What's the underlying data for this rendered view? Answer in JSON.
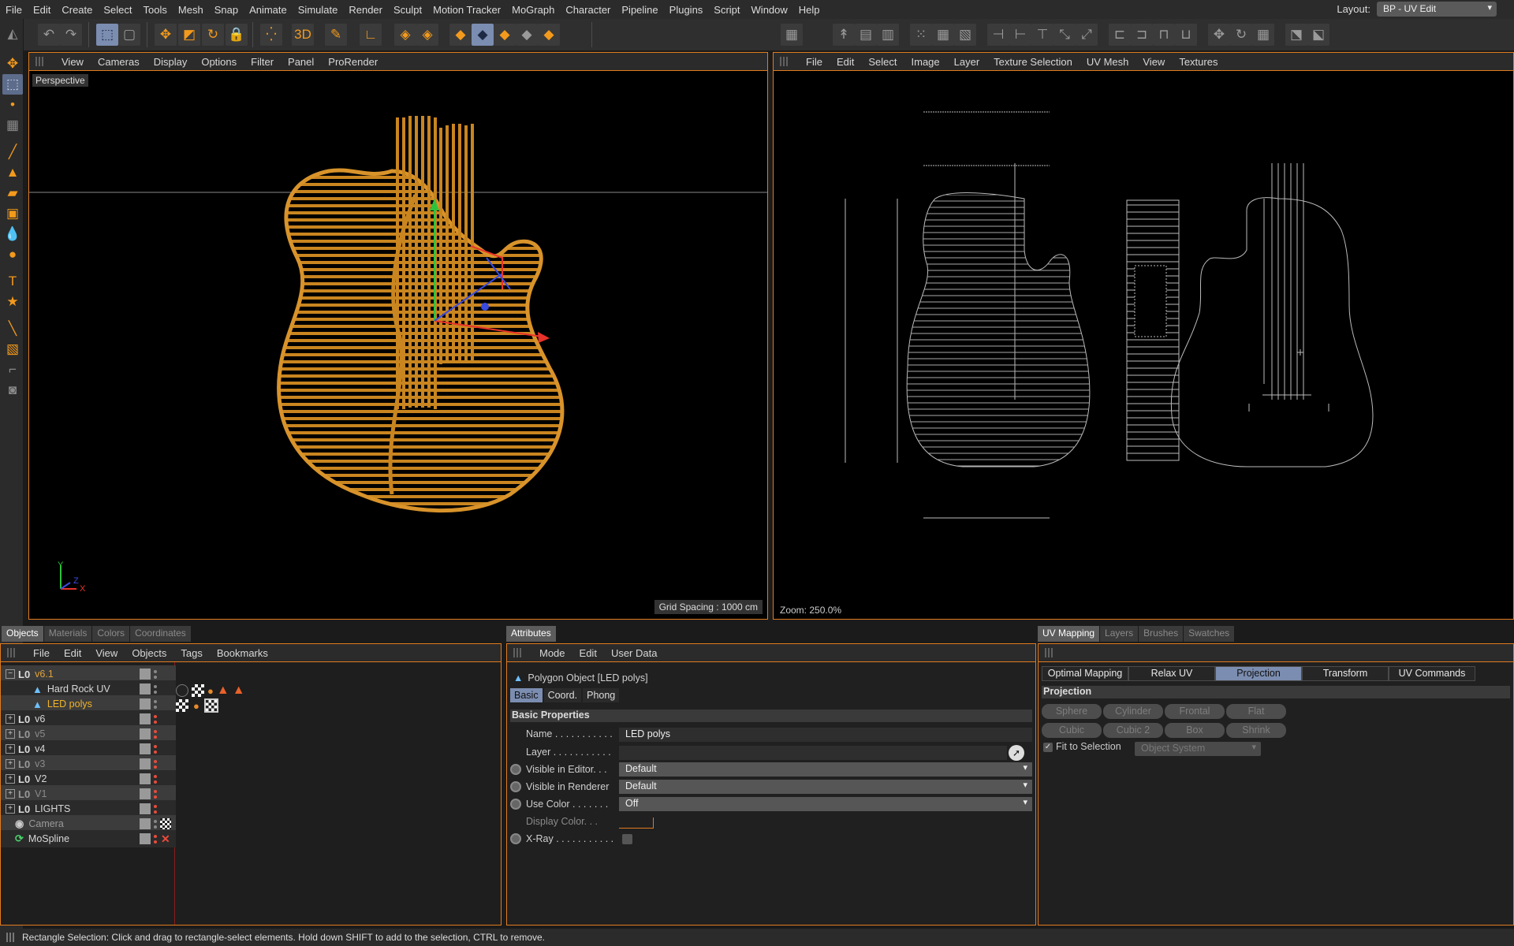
{
  "menubar": {
    "items": [
      "File",
      "Edit",
      "Create",
      "Select",
      "Tools",
      "Mesh",
      "Snap",
      "Animate",
      "Simulate",
      "Render",
      "Sculpt",
      "Motion Tracker",
      "MoGraph",
      "Character",
      "Pipeline",
      "Plugins",
      "Script",
      "Window",
      "Help"
    ],
    "layout_label": "Layout:",
    "layout_value": "BP - UV Edit"
  },
  "viewport": {
    "menu": [
      "View",
      "Cameras",
      "Display",
      "Options",
      "Filter",
      "Panel",
      "ProRender"
    ],
    "label": "Perspective",
    "grid_spacing": "Grid Spacing : 1000 cm",
    "axis_y": "Y",
    "axis_x": "X",
    "axis_z": "Z"
  },
  "uv_view": {
    "menu": [
      "File",
      "Edit",
      "Select",
      "Image",
      "Layer",
      "Texture Selection",
      "UV Mesh",
      "View",
      "Textures"
    ],
    "zoom": "Zoom: 250.0%"
  },
  "objects": {
    "tabs": [
      "Objects",
      "Materials",
      "Colors",
      "Coordinates"
    ],
    "menu": [
      "File",
      "Edit",
      "View",
      "Objects",
      "Tags",
      "Bookmarks"
    ],
    "rows": [
      {
        "name": "v6.1",
        "color": "#e0a33a",
        "dots": "grey"
      },
      {
        "name": "Hard Rock UV",
        "color": "#d8d8d8",
        "dots": "grey"
      },
      {
        "name": "LED polys",
        "color": "#f0b429",
        "dots": "grey"
      },
      {
        "name": "v6",
        "color": "#d8d8d8",
        "dots": "red"
      },
      {
        "name": "v5",
        "color": "#8a8a8a",
        "dots": "red"
      },
      {
        "name": "v4",
        "color": "#d8d8d8",
        "dots": "red"
      },
      {
        "name": "v3",
        "color": "#8a8a8a",
        "dots": "red"
      },
      {
        "name": "V2",
        "color": "#d8d8d8",
        "dots": "red"
      },
      {
        "name": "V1",
        "color": "#8a8a8a",
        "dots": "red"
      },
      {
        "name": "LIGHTS",
        "color": "#d8d8d8",
        "dots": "red"
      },
      {
        "name": "Camera",
        "color": "#9a9a9a",
        "dots": "grey"
      },
      {
        "name": "MoSpline",
        "color": "#d8d8d8",
        "dots": "red"
      }
    ]
  },
  "attributes": {
    "tab": "Attributes",
    "menu": [
      "Mode",
      "Edit",
      "User Data"
    ],
    "object_title": "Polygon Object [LED polys]",
    "subtabs": [
      "Basic",
      "Coord.",
      "Phong"
    ],
    "section": "Basic Properties",
    "name_label": "Name . . . . . . . . . . .",
    "name_value": "LED polys",
    "layer_label": "Layer . . . . . . . . . . .",
    "visible_editor_label": "Visible in Editor. . .",
    "visible_editor_value": "Default",
    "visible_renderer_label": "Visible in Renderer",
    "visible_renderer_value": "Default",
    "use_color_label": "Use Color . . . . . . .",
    "use_color_value": "Off",
    "display_color_label": "Display Color. . .",
    "xray_label": "X-Ray . . . . . . . . . . ."
  },
  "uvmapping": {
    "tabs": [
      "UV Mapping",
      "Layers",
      "Brushes",
      "Swatches"
    ],
    "subtabs": [
      "Optimal Mapping",
      "Relax UV",
      "Projection",
      "Transform",
      "UV Commands"
    ],
    "section": "Projection",
    "buttons": [
      "Sphere",
      "Cylinder",
      "Frontal",
      "Flat",
      "Cubic",
      "Cubic 2",
      "Box",
      "Shrink"
    ],
    "fit_label": "Fit to Selection",
    "fit_dropdown": "Object System"
  },
  "status": "Rectangle Selection: Click and drag to rectangle-select elements. Hold down SHIFT to add to the selection, CTRL to remove.",
  "colors": {
    "accent": "#e07b1e",
    "wire": "#c9851f",
    "selected_tab": "#7b8db0"
  }
}
